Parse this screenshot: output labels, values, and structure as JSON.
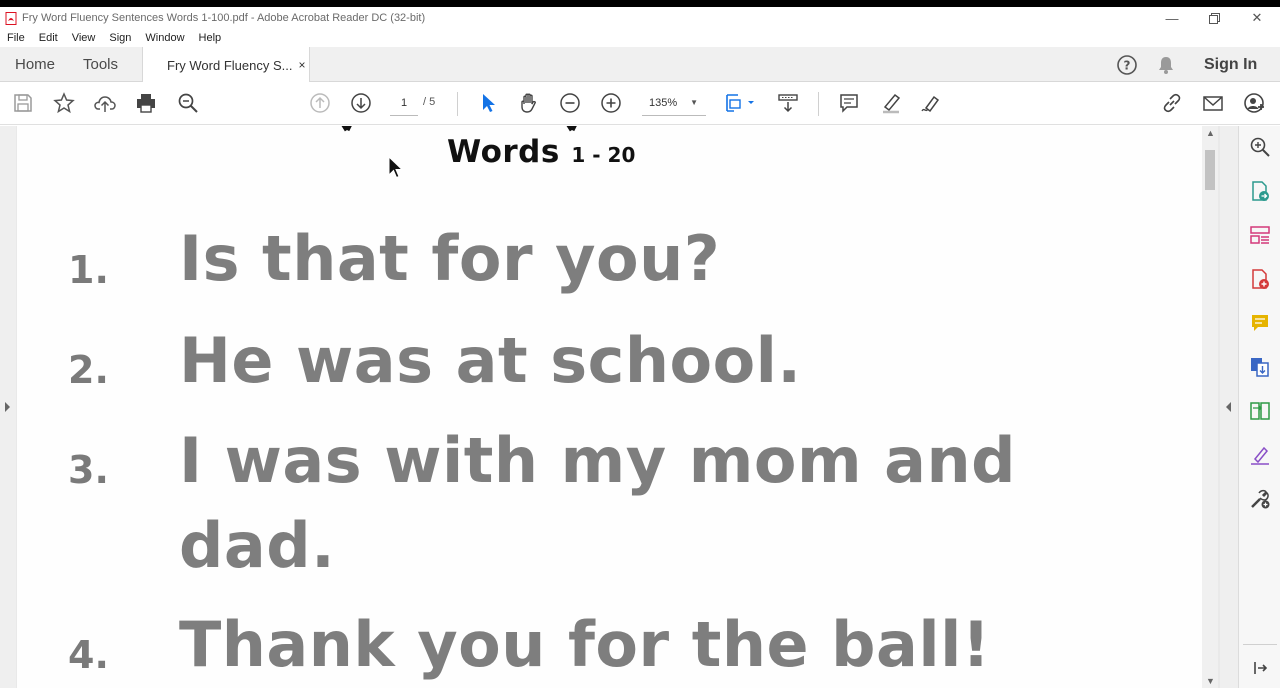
{
  "window": {
    "title": "Fry Word Fluency Sentences Words 1-100.pdf - Adobe Acrobat Reader DC (32-bit)",
    "controls": [
      "minimize-icon",
      "restore-icon",
      "close-icon"
    ]
  },
  "menu": [
    "File",
    "Edit",
    "View",
    "Sign",
    "Window",
    "Help"
  ],
  "tabs": {
    "home": "Home",
    "tools": "Tools",
    "document": "Fry Word Fluency S...",
    "close": "×"
  },
  "account": {
    "sign_in": "Sign In"
  },
  "toolbar": {
    "page_current": "1",
    "page_total": "/ 5",
    "zoom": "135%",
    "zoom_caret": "▼"
  },
  "document": {
    "heading_words": "Words",
    "heading_range": "1 - 20",
    "items": [
      {
        "num": "1.",
        "line1": "Is that for you?",
        "line2": ""
      },
      {
        "num": "2.",
        "line1": "He was at school.",
        "line2": ""
      },
      {
        "num": "3.",
        "line1": "I was with my mom and",
        "line2": "dad."
      },
      {
        "num": "4.",
        "line1": "Thank you for the ball!",
        "line2": ""
      }
    ]
  },
  "colors": {
    "accent_blue": "#1473e6",
    "sentence_gray": "#7e7e7e",
    "heading_black": "#111111"
  }
}
